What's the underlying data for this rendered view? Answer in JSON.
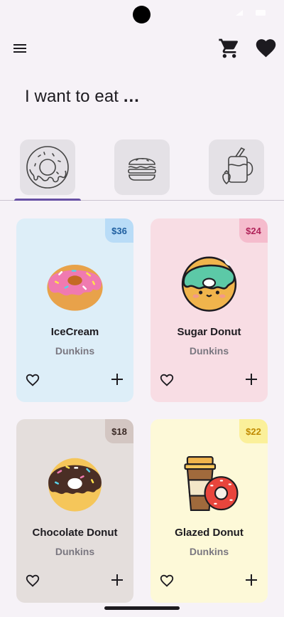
{
  "status": {
    "time": ""
  },
  "header": {
    "menu_icon": "hamburger-menu-icon",
    "cart_icon": "shopping-cart-icon",
    "favorites_icon": "heart-icon"
  },
  "headline": {
    "text": "I want to eat",
    "dots": "..."
  },
  "tabs": [
    {
      "icon": "donut-icon",
      "selected": true
    },
    {
      "icon": "burger-icon",
      "selected": false
    },
    {
      "icon": "smoothie-icon",
      "selected": false
    }
  ],
  "colors": {
    "accent": "#6750a4",
    "blue_card": "#ddeef8",
    "pink_card": "#f8dde4",
    "brown_card": "#e4dedc",
    "yellow_card": "#fdf9d8"
  },
  "products": [
    {
      "name": "IceCream",
      "brand": "Dunkins",
      "price": "$36",
      "icon": "pink-donut-icon"
    },
    {
      "name": "Sugar Donut",
      "brand": "Dunkins",
      "price": "$24",
      "icon": "mint-donut-icon"
    },
    {
      "name": "Chocolate Donut",
      "brand": "Dunkins",
      "price": "$18",
      "icon": "chocolate-donut-icon"
    },
    {
      "name": "Glazed Donut",
      "brand": "Dunkins",
      "price": "$22",
      "icon": "coffee-and-donut-icon"
    }
  ]
}
